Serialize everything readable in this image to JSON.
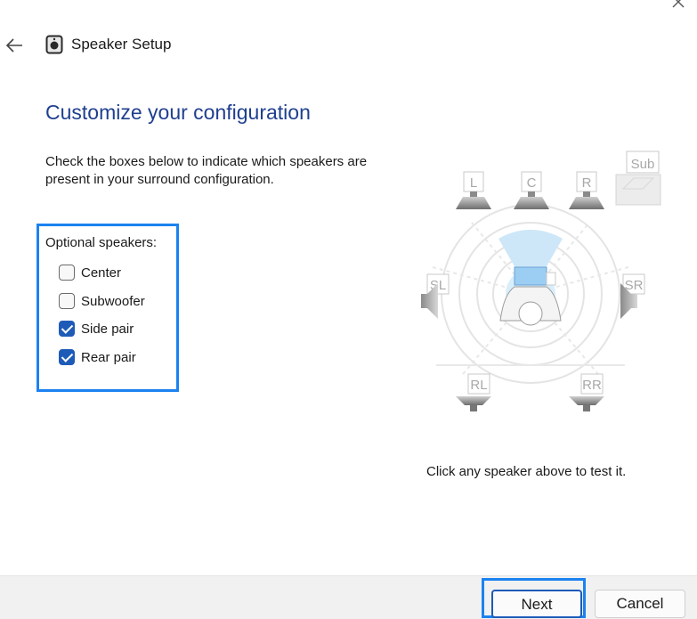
{
  "header": {
    "title": "Speaker Setup",
    "back_icon": "arrow-left-icon",
    "app_icon": "speaker-icon",
    "close_icon": "close-icon"
  },
  "main": {
    "heading": "Customize your configuration",
    "instructions": "Check the boxes below to indicate which speakers are present in your surround configuration.",
    "optional_label": "Optional speakers:",
    "options": [
      {
        "label": "Center",
        "checked": false
      },
      {
        "label": "Subwoofer",
        "checked": false
      },
      {
        "label": "Side pair",
        "checked": true
      },
      {
        "label": "Rear pair",
        "checked": true
      }
    ],
    "test_hint": "Click any speaker above to test it."
  },
  "diagram": {
    "speakers": {
      "left": "L",
      "center": "C",
      "right": "R",
      "sub": "Sub",
      "side_left": "SL",
      "side_right": "SR",
      "rear_left": "RL",
      "rear_right": "RR"
    }
  },
  "footer": {
    "next_label": "Next",
    "cancel_label": "Cancel"
  },
  "colors": {
    "heading": "#1f3f8f",
    "accent": "#1e5bb8",
    "highlight": "#1b82f0"
  }
}
